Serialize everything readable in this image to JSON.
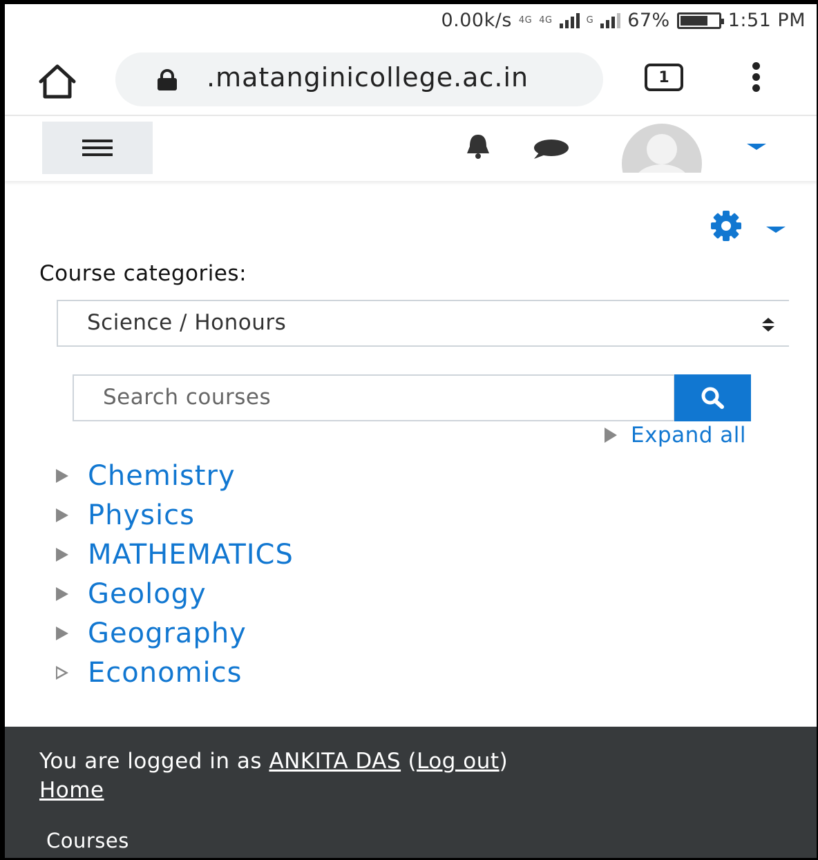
{
  "status_bar": {
    "speed": "0.00k/s",
    "net1": "4G",
    "net2": "4G",
    "net3": "G",
    "battery": "67%",
    "time": "1:51 PM"
  },
  "browser": {
    "url": ".matanginicollege.ac.in",
    "tab_count": "1"
  },
  "page": {
    "category_label": "Course categories:",
    "category_selected": "Science / Honours",
    "search_placeholder": "Search courses",
    "expand_all": "Expand all",
    "categories": [
      {
        "name": "Chemistry",
        "expanded": false
      },
      {
        "name": "Physics",
        "expanded": false
      },
      {
        "name": "MATHEMATICS",
        "expanded": false
      },
      {
        "name": "Geology",
        "expanded": false
      },
      {
        "name": "Geography",
        "expanded": false
      },
      {
        "name": "Economics",
        "expanded": false
      }
    ]
  },
  "footer": {
    "logged_in_prefix": "You are logged in as",
    "user_name": "ANKITA DAS",
    "logout": "Log out",
    "home": "Home",
    "courses": "Courses"
  },
  "colors": {
    "accent": "#1177d1",
    "footer_bg": "#373a3c"
  }
}
